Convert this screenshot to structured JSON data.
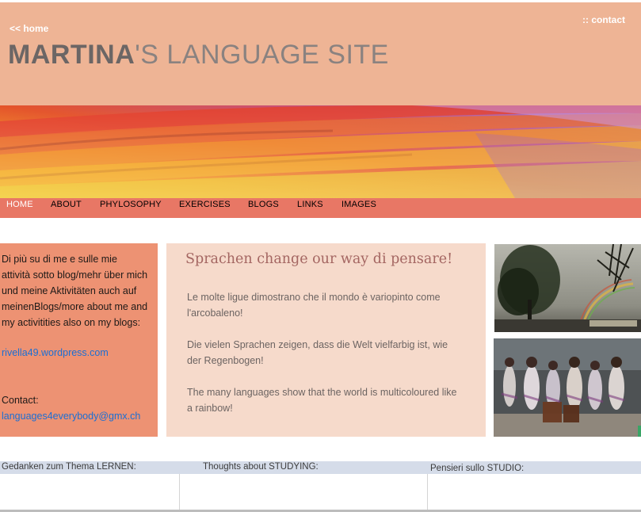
{
  "header": {
    "home_link": "<< home",
    "contact_link": ":: contact",
    "title_bold": "MARTINA",
    "title_rest": "'S LANGUAGE SITE"
  },
  "nav": {
    "items": [
      "HOME",
      "ABOUT",
      "PHYLOSOPHY",
      "EXERCISES",
      "BLOGS",
      "LINKS",
      "IMAGES"
    ],
    "active": "HOME"
  },
  "info": {
    "text": "Di più su di me e sulle mie attività sotto blog/mehr über mich und meine Aktivitäten auch auf meinenBlogs/more about me and my activitities also on my blogs:",
    "blog_link": "rivella49.wordpress.com",
    "contact_label": "Contact:",
    "email_link": "languages4everybody@gmx.ch"
  },
  "main": {
    "heading": "Sprachen change our way di pensare!",
    "paragraphs": [
      "Le molte ligue dimostrano che il mondo è variopinto come l'arcobaleno!",
      "Die vielen Sprachen zeigen, dass die Welt vielfarbig ist, wie der Regenbogen!",
      "The many languages show that the world is multicoloured like a rainbow!"
    ]
  },
  "bottom": {
    "labels": [
      "Gedanken zum Thema LERNEN:",
      "Thoughts about STUDYING:",
      "Pensieri sullo STUDIO:"
    ]
  },
  "colors": {
    "header_bg": "#eeb495",
    "nav_bg": "#e87765",
    "info_bg": "#ed9273",
    "main_bg": "#f6dacb",
    "link": "#1b6fd4",
    "heading": "#a46662"
  },
  "icons": {
    "banner": "rainbow-ribbon-image",
    "photo_top": "tree-rainbow-photo",
    "photo_bottom": "dancers-photo"
  }
}
